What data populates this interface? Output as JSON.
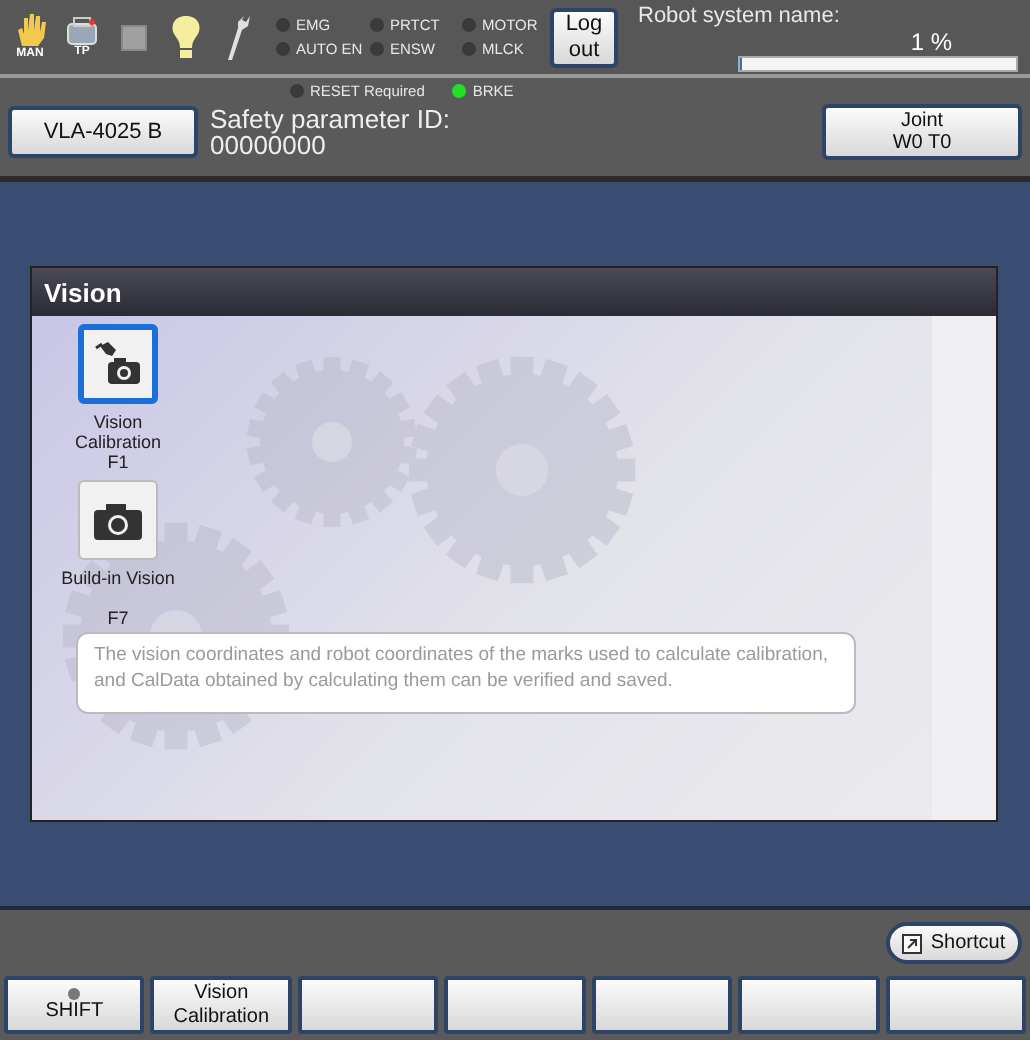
{
  "toolbar": {
    "mode_label": "MAN",
    "tp_label": "TP"
  },
  "lamps": [
    {
      "label": "EMG",
      "on": false
    },
    {
      "label": "AUTO EN",
      "on": false
    },
    {
      "label": "PRTCT",
      "on": false
    },
    {
      "label": "ENSW",
      "on": false
    },
    {
      "label": "MOTOR",
      "on": false
    },
    {
      "label": "MLCK",
      "on": false
    }
  ],
  "logout_button": "Log\nout",
  "robot_system": {
    "label": "Robot system name:",
    "reading": "1 %",
    "level": 0.01
  },
  "second_lamps": [
    {
      "label": "RESET Required",
      "on": false
    },
    {
      "label": "BRKE",
      "on": true
    }
  ],
  "robot_button": "VLA-4025 B",
  "safety": {
    "label": "Safety parameter ID:",
    "value": "00000000"
  },
  "coord_button": "Joint\nW0 T0",
  "panel": {
    "title": "Vision",
    "items": [
      {
        "kind": "calibration",
        "label": "Vision\nCalibration\nF1",
        "selected": true
      },
      {
        "kind": "camera",
        "label": "Build-in Vision\n\nF7",
        "selected": false
      }
    ],
    "description": "The vision coordinates and robot coordinates of the marks used to calculate calibration, and CalData obtained by calculating them can be verified and saved."
  },
  "shortcut_button": "Shortcut",
  "function_keys": [
    {
      "kind": "shift",
      "label": "SHIFT",
      "on": false
    },
    {
      "kind": "text",
      "label": "Vision\nCalibration"
    },
    {
      "kind": "blank"
    },
    {
      "kind": "blank"
    },
    {
      "kind": "blank"
    },
    {
      "kind": "blank"
    },
    {
      "kind": "blank"
    }
  ]
}
